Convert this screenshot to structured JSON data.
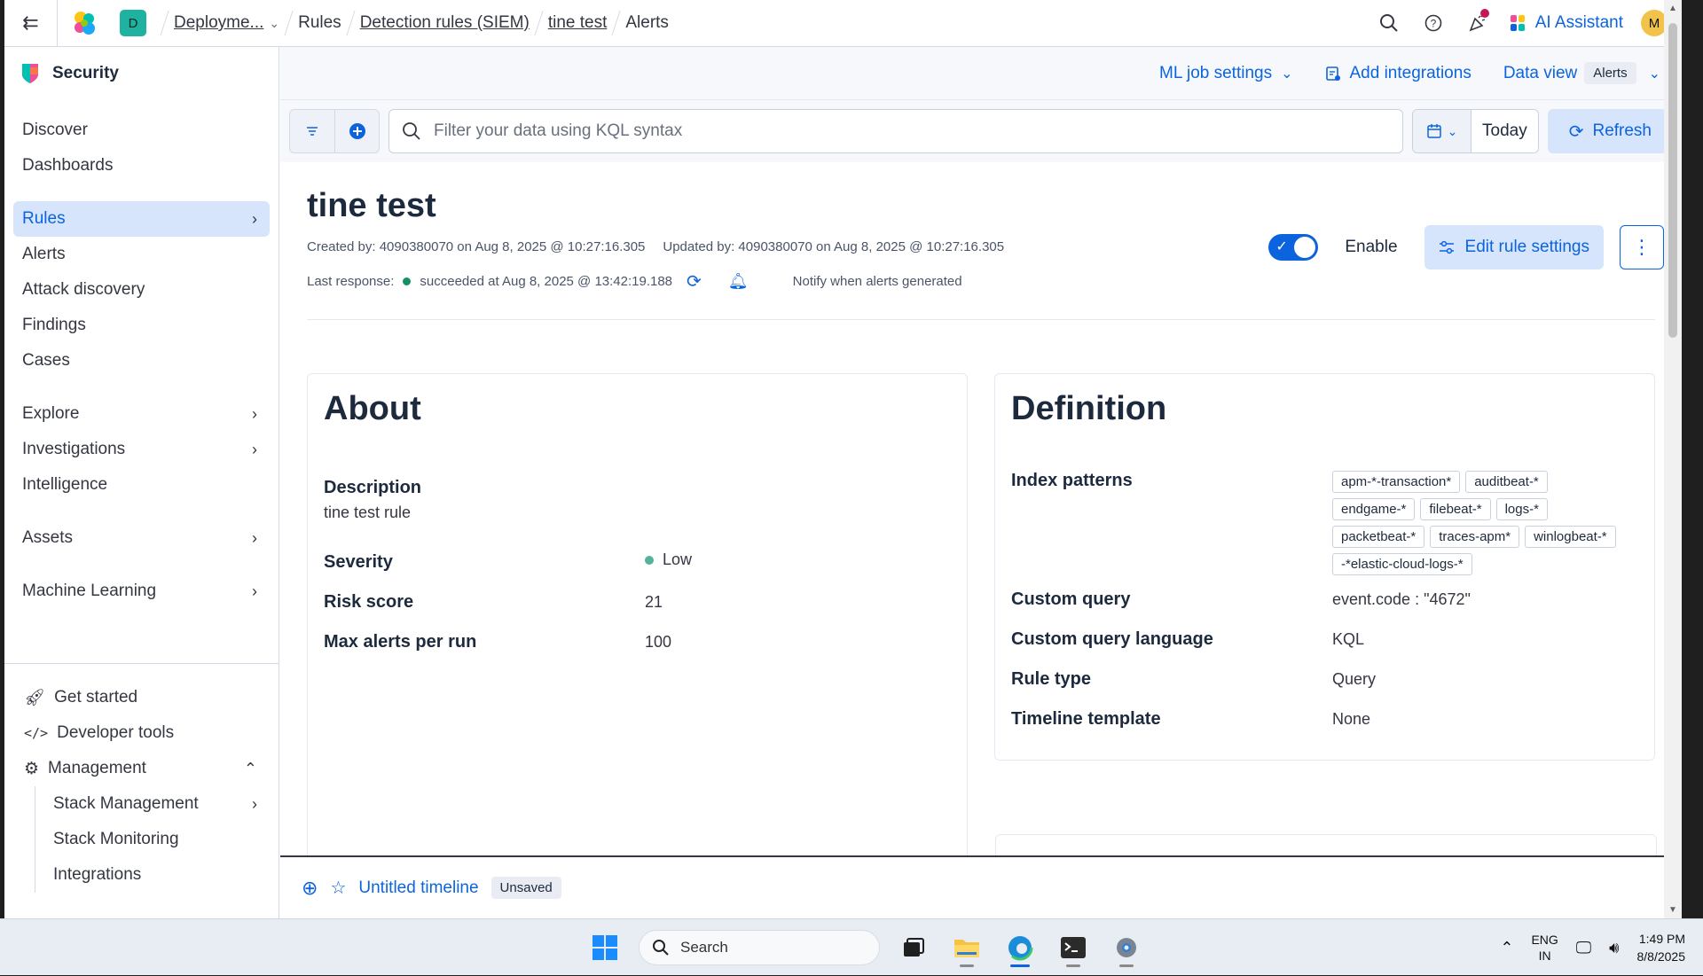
{
  "header": {
    "space_initial": "D",
    "breadcrumbs": [
      "Deployme...",
      "Rules",
      "Detection rules (SIEM)",
      "tine test",
      "Alerts"
    ],
    "ai_assistant_label": "AI Assistant",
    "avatar_initial": "M"
  },
  "sidebar": {
    "title": "Security",
    "items": [
      "Discover",
      "Dashboards",
      "Rules",
      "Alerts",
      "Attack discovery",
      "Findings",
      "Cases",
      "Explore",
      "Investigations",
      "Intelligence",
      "Assets",
      "Machine Learning"
    ],
    "footer": [
      "Get started",
      "Developer tools",
      "Management"
    ],
    "management_sub": [
      "Stack Management",
      "Stack Monitoring",
      "Integrations"
    ]
  },
  "subheader": {
    "ml_job_settings": "ML job settings",
    "add_integrations": "Add integrations",
    "data_view_label": "Data view",
    "data_view_value": "Alerts"
  },
  "querybar": {
    "placeholder": "Filter your data using KQL syntax",
    "date_label": "Today",
    "refresh_label": "Refresh"
  },
  "rule": {
    "title": "tine test",
    "created": "Created by: 4090380070 on Aug 8, 2025 @ 10:27:16.305",
    "updated": "Updated by: 4090380070 on Aug 8, 2025 @ 10:27:16.305",
    "last_response_label": "Last response:",
    "last_response_value": "succeeded at Aug 8, 2025 @ 13:42:19.188",
    "notify_text": "Notify when alerts generated",
    "enable_label": "Enable",
    "enabled": true,
    "edit_label": "Edit rule settings"
  },
  "about": {
    "heading": "About",
    "description_label": "Description",
    "description": "tine test rule",
    "severity_label": "Severity",
    "severity": "Low",
    "risk_label": "Risk score",
    "risk": "21",
    "max_alerts_label": "Max alerts per run",
    "max_alerts": "100"
  },
  "definition": {
    "heading": "Definition",
    "index_label": "Index patterns",
    "index_patterns": [
      "apm-*-transaction*",
      "auditbeat-*",
      "endgame-*",
      "filebeat-*",
      "logs-*",
      "packetbeat-*",
      "traces-apm*",
      "winlogbeat-*",
      "-*elastic-cloud-logs-*"
    ],
    "custom_query_label": "Custom query",
    "custom_query": "event.code : \"4672\"",
    "query_language_label": "Custom query language",
    "query_language": "KQL",
    "rule_type_label": "Rule type",
    "rule_type": "Query",
    "timeline_template_label": "Timeline template",
    "timeline_template": "None"
  },
  "timeline": {
    "title": "Untitled timeline",
    "status": "Unsaved"
  },
  "taskbar": {
    "search_label": "Search",
    "lang_top": "ENG",
    "lang_bottom": "IN",
    "time": "1:49 PM",
    "date": "8/8/2025"
  },
  "colors": {
    "accent": "#0b64dd",
    "success": "#138f6a",
    "severity_low": "#54b399"
  }
}
